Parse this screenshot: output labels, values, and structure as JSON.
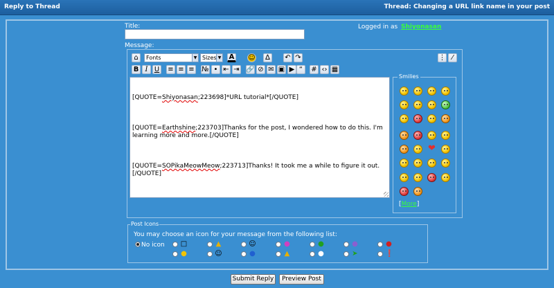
{
  "header": {
    "title": "Reply to Thread",
    "thread": "Thread: Changing a URL link name in your post"
  },
  "form": {
    "title_label": "Title:",
    "title_value": "",
    "message_label": "Message:",
    "logged_in_prefix": "Logged in as",
    "username": "Shiyonasan"
  },
  "toolbar": {
    "font_select": "Fonts",
    "size_select": "Sizes"
  },
  "message": {
    "lines": [
      [
        "[QUOTE=",
        "Shiyonasan",
        ";223698]*URL tutorial*[/QUOTE]"
      ],
      [
        "[QUOTE=",
        "Earthshine",
        ";223703]Thanks for the post, I wondered how to do this. I'm learning more and more.[/QUOTE]"
      ],
      [
        "[QUOTE=",
        "SOPikaMeowMeow",
        ";223713]Thanks! It took me a while to figure it out.[/QUOTE]"
      ]
    ]
  },
  "smilies": {
    "legend": "Smilies",
    "more_prefix": "[",
    "more_label": "More",
    "more_suffix": "]"
  },
  "post_icons": {
    "legend": "Post Icons",
    "hint": "You may choose an icon for your message from the following list:",
    "no_icon_label": "No icon",
    "selected": "no-icon"
  },
  "buttons": {
    "submit": "Submit Reply",
    "preview": "Preview Post"
  }
}
